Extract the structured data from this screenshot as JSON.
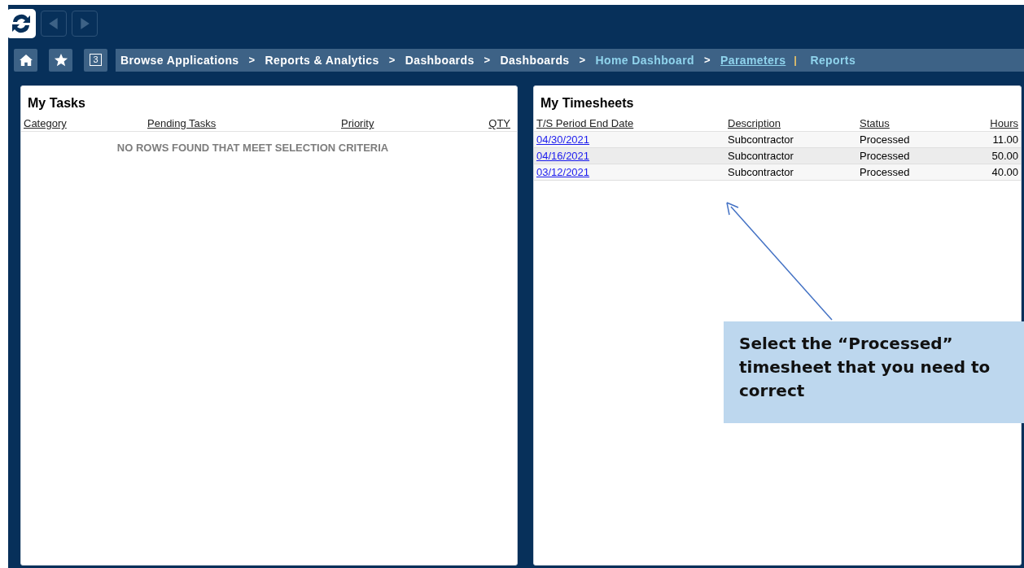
{
  "breadcrumbs": [
    {
      "label": "Browse Applications",
      "kind": "crumb",
      "separator": ">"
    },
    {
      "label": "Reports & Analytics",
      "kind": "crumb",
      "separator": ">"
    },
    {
      "label": "Dashboards",
      "kind": "crumb",
      "separator": ">"
    },
    {
      "label": "Dashboards",
      "kind": "crumb",
      "separator": ">"
    },
    {
      "label": "Home Dashboard",
      "kind": "current",
      "separator": ">"
    },
    {
      "label": "Parameters",
      "kind": "link",
      "separator": "|"
    },
    {
      "label": "Reports",
      "kind": "action"
    }
  ],
  "toolbar": {
    "badge": "3"
  },
  "tasks": {
    "title": "My Tasks",
    "columns": [
      "Category",
      "Pending Tasks",
      "Priority",
      "QTY"
    ],
    "empty_message": "NO ROWS FOUND THAT MEET SELECTION CRITERIA"
  },
  "timesheets": {
    "title": "My Timesheets",
    "columns": [
      "T/S Period End Date",
      "Description",
      "Status",
      "Hours"
    ],
    "rows": [
      {
        "date": "04/30/2021",
        "description": "Subcontractor",
        "status": "Processed",
        "hours": "11.00"
      },
      {
        "date": "04/16/2021",
        "description": "Subcontractor",
        "status": "Processed",
        "hours": "50.00"
      },
      {
        "date": "03/12/2021",
        "description": "Subcontractor",
        "status": "Processed",
        "hours": "40.00"
      }
    ]
  },
  "callout": {
    "text": "Select the “Processed” timesheet that you need to correct"
  }
}
